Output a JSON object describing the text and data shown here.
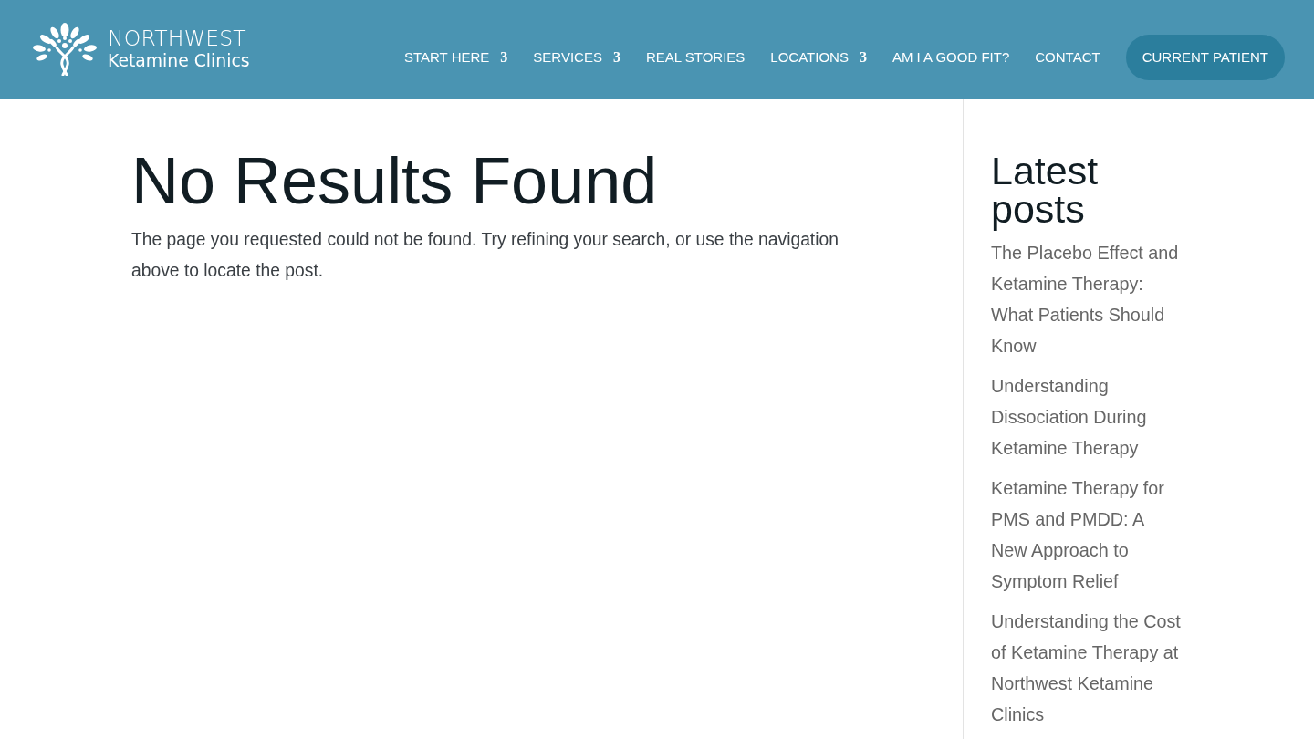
{
  "header": {
    "logo": {
      "line_1": "NORTHWEST",
      "line_2": "Ketamine Clinics"
    },
    "nav": [
      {
        "kind": "link",
        "label": "START HERE",
        "glyph": "3"
      },
      {
        "kind": "link",
        "label": "SERVICES",
        "glyph": "3"
      },
      {
        "kind": "link",
        "label": "REAL STORIES"
      },
      {
        "kind": "link",
        "label": "LOCATIONS",
        "glyph": "3"
      },
      {
        "kind": "link",
        "label": "AM I A GOOD FIT?"
      },
      {
        "kind": "link",
        "label": "CONTACT"
      },
      {
        "kind": "button",
        "label": "CURRENT PATIENT"
      }
    ]
  },
  "main": {
    "title": "No Results Found",
    "message": "The page you requested could not be found. Try refining your search, or use the navigation above to locate the post."
  },
  "sidebar": {
    "title": "Latest posts",
    "posts": [
      "The Placebo Effect and Ketamine Therapy: What Patients Should Know",
      "Understanding Dissociation During Ketamine Therapy",
      "Ketamine Therapy for PMS and PMDD: A New Approach to Symptom Relief",
      "Understanding the Cost of Ketamine Therapy at Northwest Ketamine Clinics"
    ]
  }
}
